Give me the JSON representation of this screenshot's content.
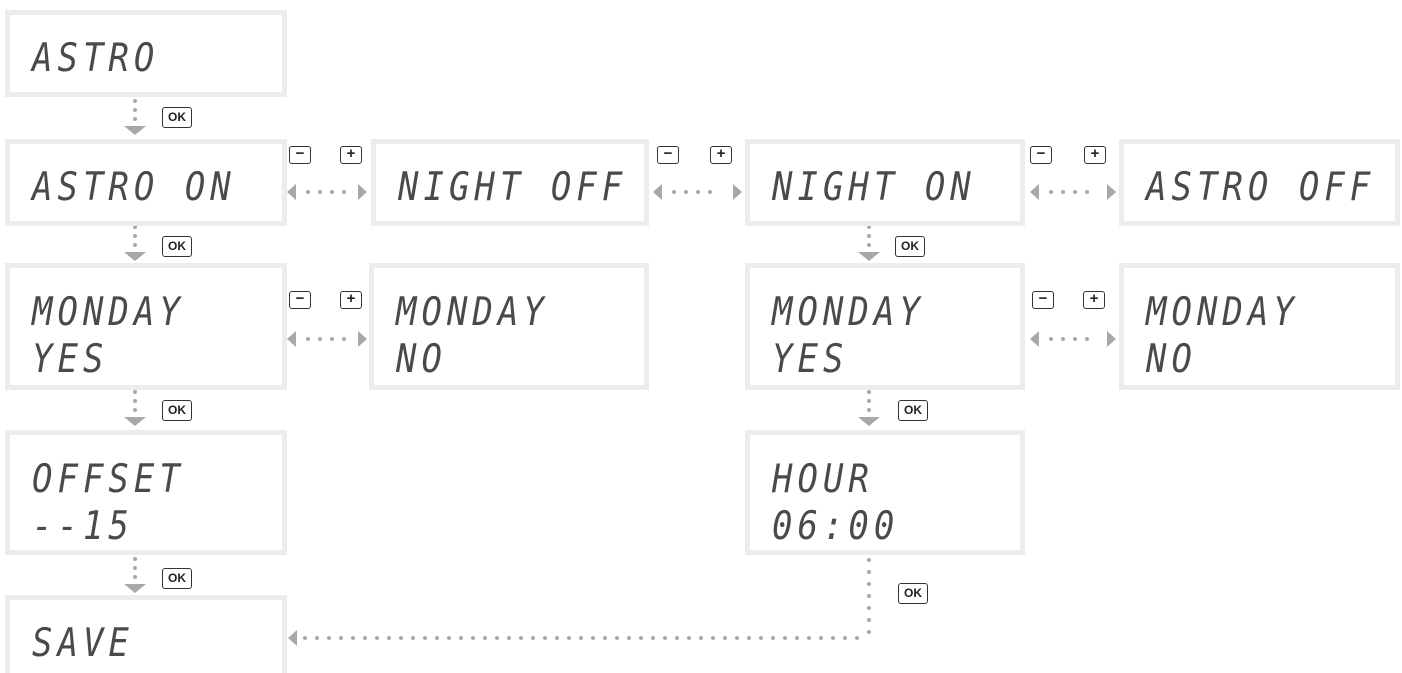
{
  "screens": {
    "astro": [
      "ASTRO"
    ],
    "astro_on": [
      "ASTRO ON"
    ],
    "night_off": [
      "NIGHT OFF"
    ],
    "night_on": [
      "NIGHT ON"
    ],
    "astro_off": [
      "ASTRO OFF"
    ],
    "monday_yes_left": [
      "MONDAY",
      "YES"
    ],
    "monday_no_left": [
      "MONDAY",
      "NO"
    ],
    "monday_yes_right": [
      "MONDAY",
      "YES"
    ],
    "monday_no_right": [
      "MONDAY",
      "NO"
    ],
    "offset": [
      "OFFSET",
      "--15"
    ],
    "hour": [
      "HOUR",
      "06:00"
    ],
    "save": [
      "SAVE"
    ]
  },
  "keys": {
    "ok": "OK",
    "minus": "−",
    "plus": "+"
  },
  "colors": {
    "screen_border": "#ececec",
    "lcd_text": "#4a4a4a",
    "connector": "#a8a8a8",
    "key_border": "#333333"
  }
}
